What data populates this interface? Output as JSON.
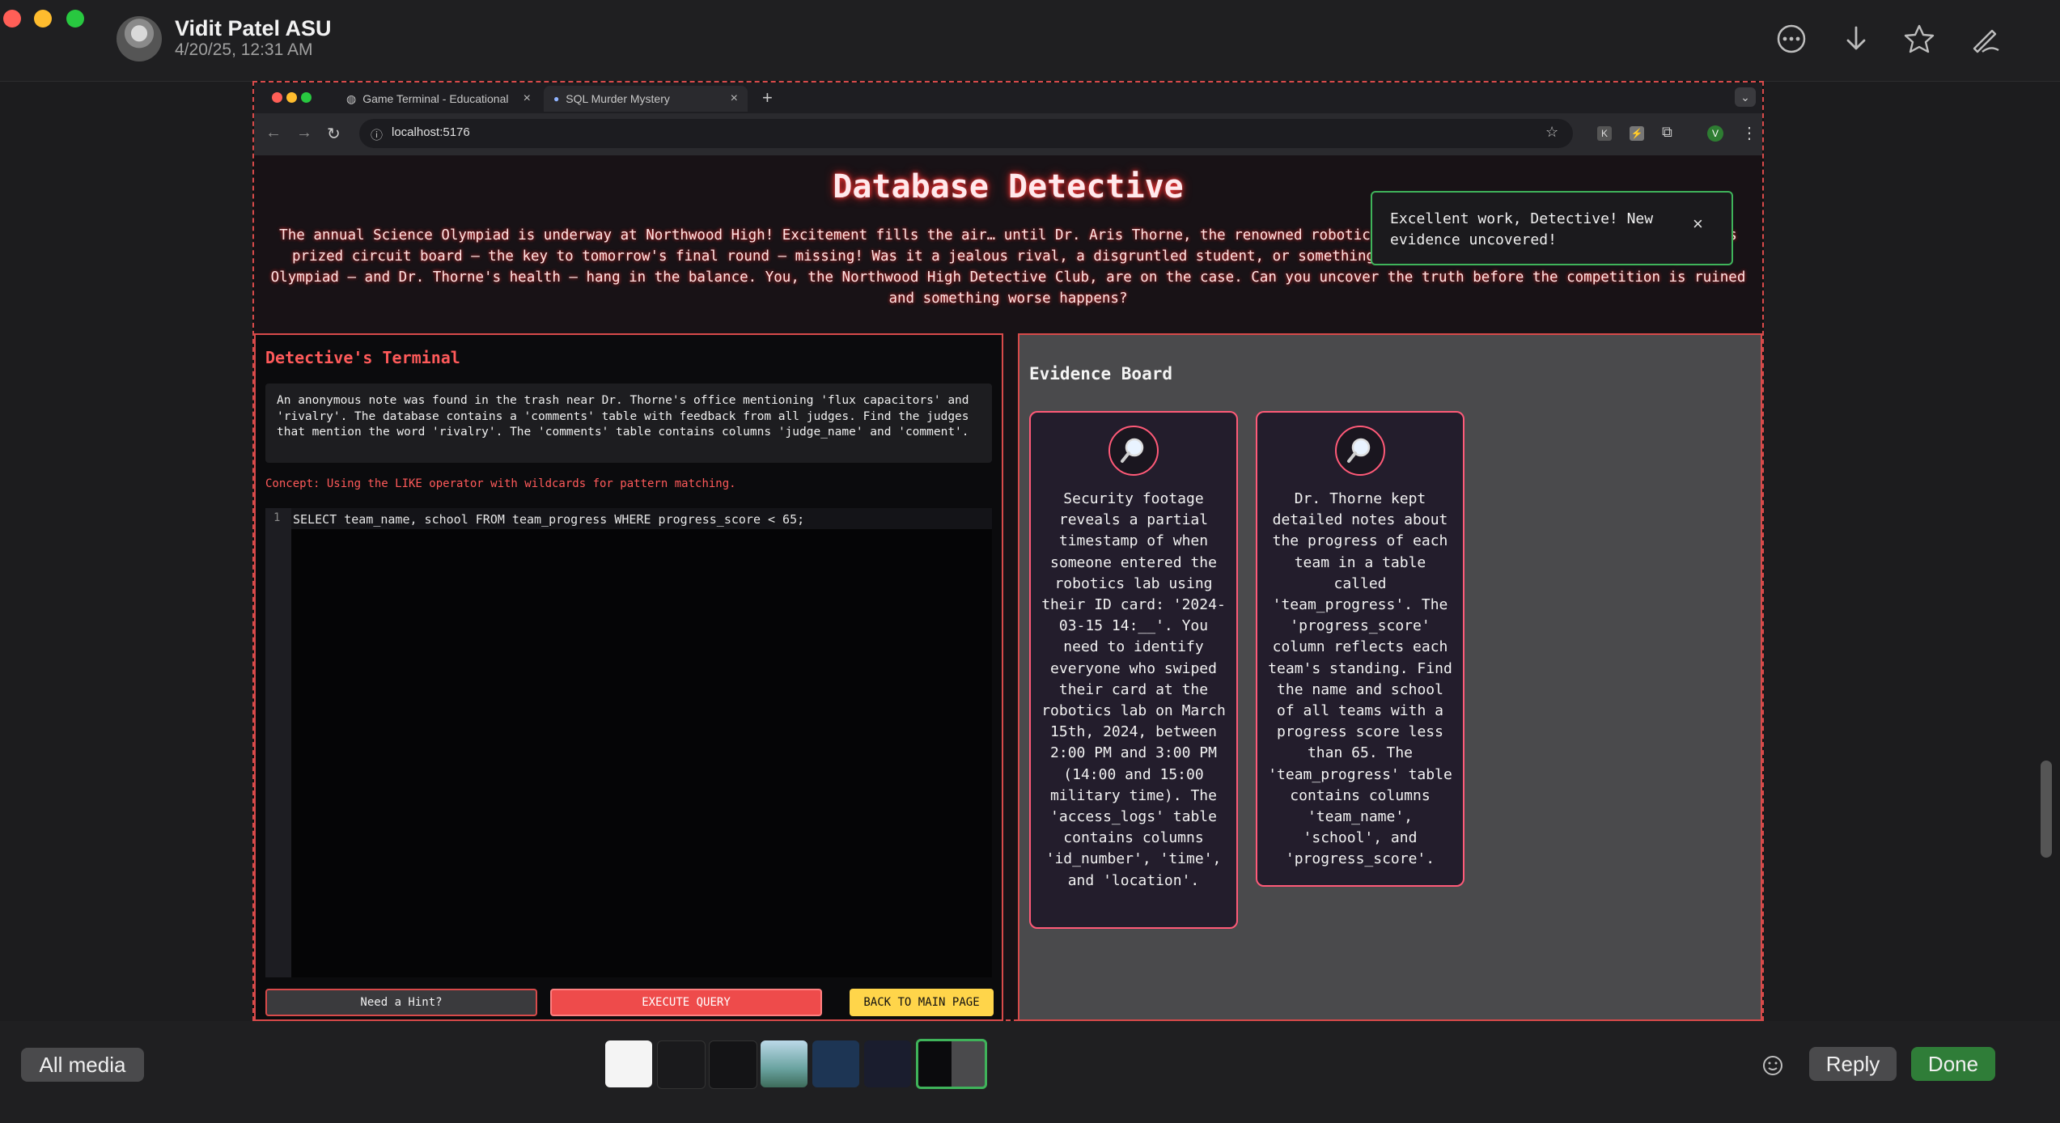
{
  "viewer": {
    "sender_name": "Vidit Patel ASU",
    "sent_time": "4/20/25, 12:31 AM",
    "icons": [
      "more-icon",
      "download-icon",
      "star-icon",
      "markup-icon"
    ]
  },
  "browser": {
    "tabs": [
      {
        "label": "Game Terminal - Educational",
        "active": false
      },
      {
        "label": "SQL Murder Mystery",
        "active": true
      }
    ],
    "new_tab": "+",
    "url": "localhost:5176",
    "profile_initial": "V"
  },
  "game": {
    "title": "Database Detective",
    "intro": "The annual Science Olympiad is underway at Northwood High! Excitement fills the air… until Dr. Aris Thorne, the renowned robotics coach, collapses in the robotics lab, his prized circuit board — the key to tomorrow's final round — missing! Was it a jealous rival, a disgruntled student, or something more sinister? The clock is ticking; the Olympiad — and Dr. Thorne's health — hang in the balance. You, the Northwood High Detective Club, are on the case. Can you uncover the truth before the competition is ruined and something worse happens?",
    "toast": {
      "message": "Excellent work, Detective! New evidence uncovered!",
      "close": "×"
    },
    "terminal": {
      "title": "Detective's Terminal",
      "description": "An anonymous note was found in the trash near Dr. Thorne's office mentioning 'flux capacitors' and 'rivalry'. The database contains a 'comments' table with feedback from all judges. Find the judges that mention the word 'rivalry'. The 'comments' table contains columns 'judge_name' and 'comment'.",
      "concept": "Concept: Using the LIKE operator with wildcards for pattern matching.",
      "line_number": "1",
      "query": "SELECT team_name, school FROM team_progress WHERE progress_score < 65;",
      "hint_button": "Need a Hint?",
      "execute_button": "EXECUTE QUERY",
      "back_button": "BACK TO MAIN PAGE"
    },
    "evidence": {
      "title": "Evidence Board",
      "cards": [
        {
          "icon": "magnifier-icon",
          "text": "Security footage reveals a partial timestamp of when someone entered the robotics lab using their ID card: '2024-03-15 14:__'. You need to identify everyone who swiped their card at the robotics lab on March 15th, 2024, between 2:00 PM and 3:00 PM (14:00 and 15:00 military time). The 'access_logs' table contains columns 'id_number', 'time', and 'location'."
        },
        {
          "icon": "magnifier-icon",
          "text": "Dr. Thorne kept detailed notes about the progress of each team in a table called 'team_progress'. The 'progress_score' column reflects each team's standing. Find the name and school of all teams with a progress score less than 65. The 'team_progress' table contains columns 'team_name', 'school', and 'progress_score'."
        }
      ]
    }
  },
  "bottom": {
    "all_media": "All media",
    "reply": "Reply",
    "done": "Done"
  },
  "colors": {
    "accent": "#d84a4a",
    "done": "#2f7d38",
    "toast_border": "#3fb35a",
    "back_button": "#ffd54a"
  }
}
